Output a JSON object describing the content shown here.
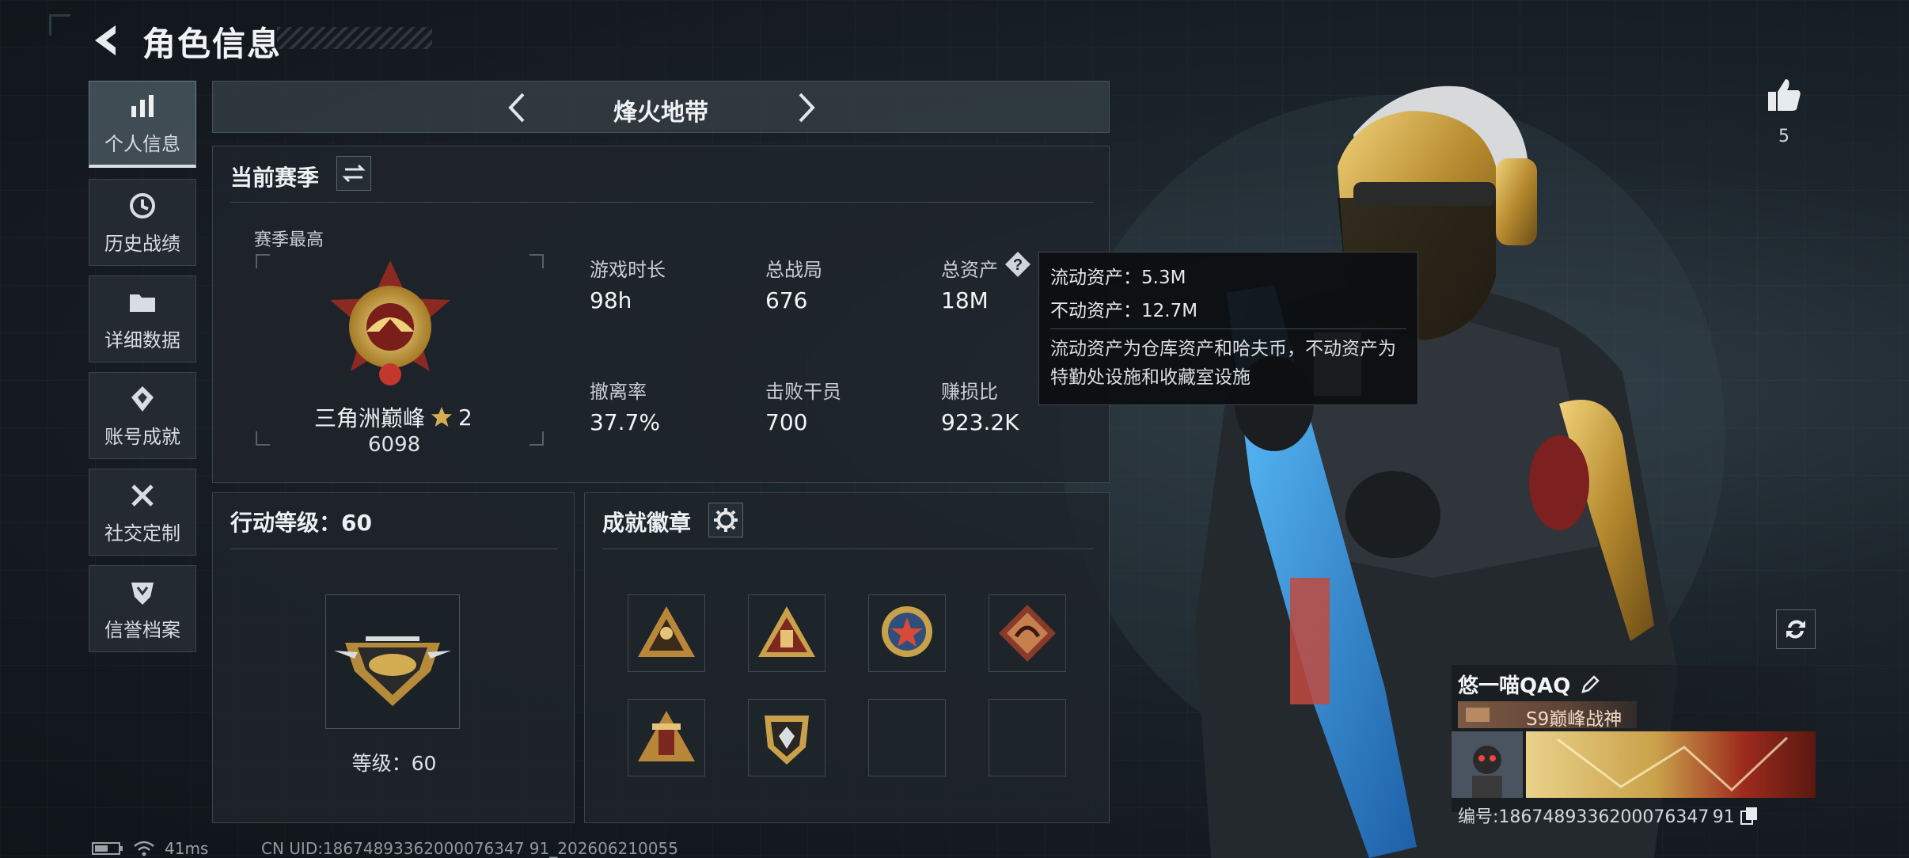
{
  "header": {
    "title": "角色信息"
  },
  "sidebar": {
    "items": [
      {
        "label": "个人信息",
        "icon": "bar-chart-icon",
        "active": true
      },
      {
        "label": "历史战绩",
        "icon": "history-clock-icon"
      },
      {
        "label": "详细数据",
        "icon": "folder-icon"
      },
      {
        "label": "账号成就",
        "icon": "achievement-icon"
      },
      {
        "label": "社交定制",
        "icon": "tools-icon"
      },
      {
        "label": "信誉档案",
        "icon": "shield-icon"
      }
    ]
  },
  "mode_selector": {
    "name": "烽火地带"
  },
  "season": {
    "title": "当前赛季",
    "best_label": "赛季最高",
    "rank_name": "三角洲巅峰",
    "rank_stars": "2",
    "rank_score": "6098",
    "stats": [
      {
        "label": "游戏时长",
        "value": "98h"
      },
      {
        "label": "总战局",
        "value": "676"
      },
      {
        "label": "总资产",
        "value": "18M"
      },
      {
        "label": "撤离率",
        "value": "37.7%"
      },
      {
        "label": "击败干员",
        "value": "700"
      },
      {
        "label": "赚损比",
        "value": "923.2K"
      }
    ]
  },
  "tooltip": {
    "liquid": "流动资产：5.3M",
    "fixed": "不动资产：12.7M",
    "desc": "流动资产为仓库资产和哈夫币，不动资产为特勤处设施和收藏室设施"
  },
  "action_level": {
    "title": "行动等级：60",
    "level_text": "等级：60"
  },
  "achievements": {
    "title": "成就徽章"
  },
  "profile": {
    "likes": "5",
    "player_name": "悠一喵QAQ",
    "title_tag": "S9巅峰战神",
    "id_text": "编号:1867489336200076347 91"
  },
  "status": {
    "ping": "41ms",
    "uid": "CN UID:18674893362000076347 91_202606210055"
  },
  "colors": {
    "accent_gold": "#c9a14a",
    "tag_brown": "#7b5a44"
  }
}
